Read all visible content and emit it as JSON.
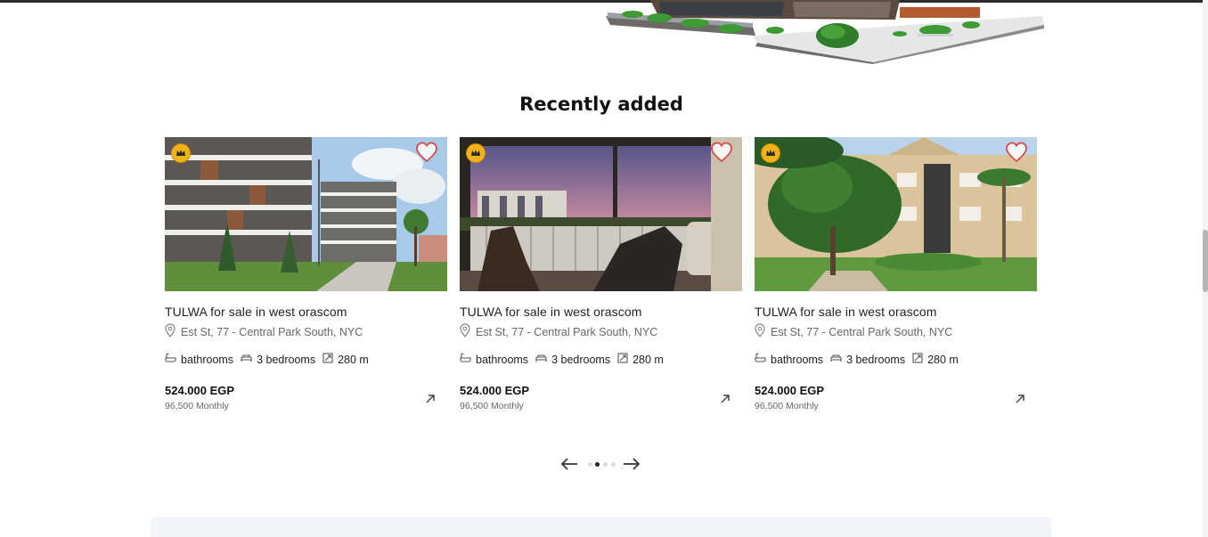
{
  "section": {
    "title": "Recently added"
  },
  "listings": [
    {
      "title": "TULWA for sale in west orascom",
      "address": "Est St, 77 - Central Park South, NYC",
      "bathrooms": "bathrooms",
      "bedrooms": "3 bedrooms",
      "area": "280 m",
      "price": "524.000 EGP",
      "monthly": "96,500 Monthly",
      "image": "modern-apartment-complex"
    },
    {
      "title": "TULWA for sale in west orascom",
      "address": "Est St, 77 - Central Park South, NYC",
      "bathrooms": "bathrooms",
      "bedrooms": "3 bedrooms",
      "area": "280 m",
      "price": "524.000 EGP",
      "monthly": "96,500 Monthly",
      "image": "sunset-balcony-with-exercise-bike"
    },
    {
      "title": "TULWA for sale in west orascom",
      "address": "Est St, 77 - Central Park South, NYC",
      "bathrooms": "bathrooms",
      "bedrooms": "3 bedrooms",
      "area": "280 m",
      "price": "524.000 EGP",
      "monthly": "96,500 Monthly",
      "image": "beige-condo-with-trees"
    }
  ],
  "pager": {
    "pages": 4,
    "active_page": 2
  },
  "icons": {
    "badge": "crown-badge-icon",
    "favorite": "heart-icon",
    "location": "location-pin-icon",
    "bath": "bathtub-icon",
    "bed": "bed-icon",
    "area": "area-icon",
    "open": "arrow-up-right-icon",
    "prev": "arrow-left-icon",
    "next": "arrow-right-icon"
  },
  "colors": {
    "accent_badge": "#f1b21a",
    "heart": "#d84a4a",
    "panel": "#f1f4f9"
  }
}
